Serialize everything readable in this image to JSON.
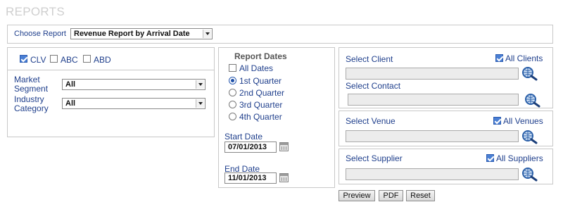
{
  "page": {
    "title": "REPORTS"
  },
  "choose_report": {
    "label": "Choose Report",
    "selected": "Revenue Report by Arrival Date"
  },
  "filters": {
    "codes": [
      {
        "label": "CLV",
        "checked": true
      },
      {
        "label": "ABC",
        "checked": false
      },
      {
        "label": "ABD",
        "checked": false
      }
    ],
    "market_segment": {
      "label_line1": "Market",
      "label_line2": "Segment",
      "selected": "All"
    },
    "industry_category": {
      "label_line1": "Industry",
      "label_line2": "Category",
      "selected": "All"
    }
  },
  "report_dates": {
    "title": "Report Dates",
    "all_dates": {
      "label": "All Dates",
      "checked": false
    },
    "quarters": [
      {
        "label": "1st Quarter",
        "selected": true
      },
      {
        "label": "2nd Quarter",
        "selected": false
      },
      {
        "label": "3rd Quarter",
        "selected": false
      },
      {
        "label": "4th Quarter",
        "selected": false
      }
    ],
    "start_date": {
      "label": "Start Date",
      "value": "07/01/2013"
    },
    "end_date": {
      "label": "End Date",
      "value": "11/01/2013"
    }
  },
  "client": {
    "label": "Select Client",
    "all_label": "All Clients",
    "all_checked": true,
    "value": ""
  },
  "contact": {
    "label": "Select Contact",
    "value": ""
  },
  "venue": {
    "label": "Select Venue",
    "all_label": "All Venues",
    "all_checked": true,
    "value": ""
  },
  "supplier": {
    "label": "Select Supplier",
    "all_label": "All Suppliers",
    "all_checked": true,
    "value": ""
  },
  "actions": {
    "preview": "Preview",
    "pdf": "PDF",
    "reset": "Reset"
  },
  "icons": {
    "search": "magnifier-globe-icon",
    "calendar": "calendar-icon"
  },
  "colors": {
    "label_blue": "#1f3f8c",
    "check_blue": "#4a7fd4",
    "title_gray": "#cfcfcf"
  }
}
